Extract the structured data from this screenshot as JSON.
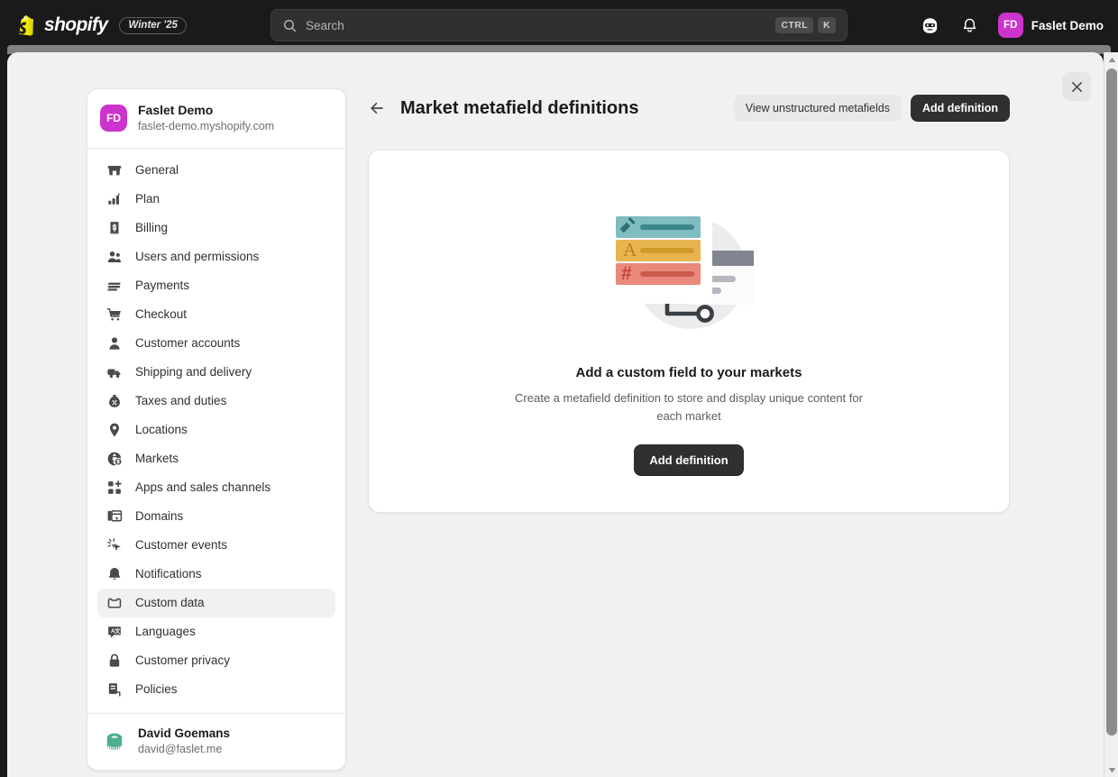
{
  "topbar": {
    "logo_icon": "shopify-bag-icon",
    "brand_word": "shopify",
    "season_badge": "Winter '25",
    "search": {
      "icon": "search-icon",
      "placeholder": "Search",
      "keys": [
        "CTRL",
        "K"
      ]
    },
    "mascot_icon": "shopify-mascot-icon",
    "notifications_icon": "bell-icon",
    "user": {
      "initials": "FD",
      "name": "Faslet Demo"
    }
  },
  "window": {
    "close_icon": "close-icon",
    "scroll_up_icon": "scroll-up-arrow-icon",
    "scroll_down_icon": "scroll-down-arrow-icon"
  },
  "sidebar": {
    "store": {
      "initials": "FD",
      "name": "Faslet Demo",
      "domain": "faslet-demo.myshopify.com"
    },
    "items": [
      {
        "label": "General",
        "icon": "store-icon",
        "active": false
      },
      {
        "label": "Plan",
        "icon": "chart-bar-icon",
        "active": false
      },
      {
        "label": "Billing",
        "icon": "receipt-dollar-icon",
        "active": false
      },
      {
        "label": "Users and permissions",
        "icon": "users-icon",
        "active": false
      },
      {
        "label": "Payments",
        "icon": "credit-card-icon",
        "active": false
      },
      {
        "label": "Checkout",
        "icon": "cart-icon",
        "active": false
      },
      {
        "label": "Customer accounts",
        "icon": "person-icon",
        "active": false
      },
      {
        "label": "Shipping and delivery",
        "icon": "truck-icon",
        "active": false
      },
      {
        "label": "Taxes and duties",
        "icon": "tax-bag-icon",
        "active": false
      },
      {
        "label": "Locations",
        "icon": "map-pin-icon",
        "active": false
      },
      {
        "label": "Markets",
        "icon": "globe-dollar-icon",
        "active": false
      },
      {
        "label": "Apps and sales channels",
        "icon": "apps-plus-icon",
        "active": false
      },
      {
        "label": "Domains",
        "icon": "domain-window-icon",
        "active": false
      },
      {
        "label": "Customer events",
        "icon": "cursor-click-icon",
        "active": false
      },
      {
        "label": "Notifications",
        "icon": "bell-icon",
        "active": false
      },
      {
        "label": "Custom data",
        "icon": "metafields-box-icon",
        "active": true
      },
      {
        "label": "Languages",
        "icon": "translate-icon",
        "active": false
      },
      {
        "label": "Customer privacy",
        "icon": "lock-icon",
        "active": false
      },
      {
        "label": "Policies",
        "icon": "policy-document-icon",
        "active": false
      }
    ],
    "user": {
      "avatar_icon": "measuring-tape-avatar-icon",
      "name": "David Goemans",
      "email": "david@faslet.me"
    }
  },
  "main": {
    "back_icon": "back-arrow-icon",
    "title": "Market metafield definitions",
    "actions": {
      "secondary_label": "View unstructured metafields",
      "primary_label": "Add definition"
    },
    "empty_state": {
      "illustration_icon": "metafield-definitions-illustration",
      "title": "Add a custom field to your markets",
      "subtitle": "Create a metafield definition to store and display unique content for each market",
      "button_label": "Add definition"
    }
  },
  "colors": {
    "topbar_bg": "#1a1a1a",
    "app_bg": "#f1f1f1",
    "accent_magenta": "#cc33cc",
    "brand_yellow": "#f3e800",
    "primary_button": "#303030",
    "illustration_teal": "#7fbdc1",
    "illustration_amber": "#e8b44f",
    "illustration_salmon": "#e8897c",
    "avatar_green": "#4caf8f"
  }
}
